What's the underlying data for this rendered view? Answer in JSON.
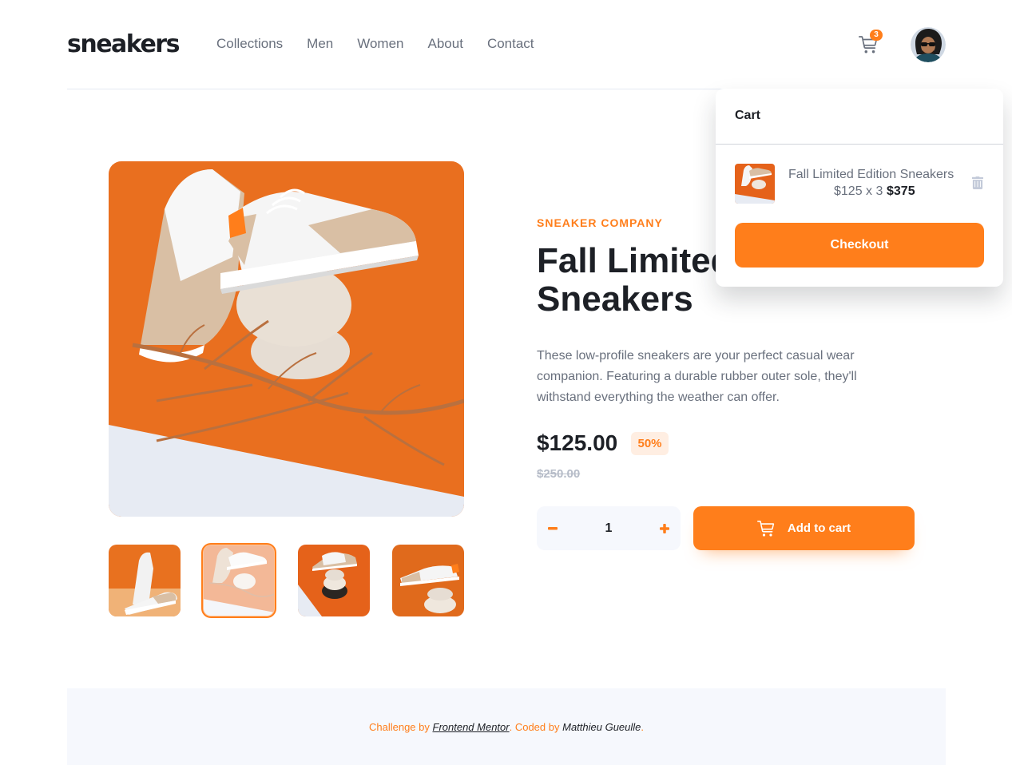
{
  "header": {
    "logo": "sneakers",
    "nav": [
      "Collections",
      "Men",
      "Women",
      "About",
      "Contact"
    ],
    "cart_count": "3"
  },
  "product": {
    "company": "SNEAKER COMPANY",
    "title": "Fall Limited Edition Sneakers",
    "description": "These low-profile sneakers are your perfect casual wear companion. Featuring a durable rubber outer sole, they'll withstand everything the weather can offer.",
    "price": "$125.00",
    "discount": "50%",
    "original_price": "$250.00",
    "quantity": "1",
    "add_to_cart_label": "Add to cart",
    "active_thumbnail": 2
  },
  "cart": {
    "title": "Cart",
    "item_name": "Fall Limited Edition Sneakers",
    "item_calc": "$125 x 3",
    "item_total": "$375",
    "checkout_label": "Checkout"
  },
  "footer": {
    "challenge_prefix": "Challenge by",
    "challenge_link": "Frontend Mentor",
    "coded_prefix": ". Coded by",
    "author": "Matthieu Gueulle",
    "suffix": "."
  },
  "colors": {
    "accent": "#ff7e1b",
    "accent_pale": "#ffeee2",
    "text_dark": "#1d2026",
    "text_gray": "#69707d",
    "light_bg": "#f6f8fd"
  }
}
